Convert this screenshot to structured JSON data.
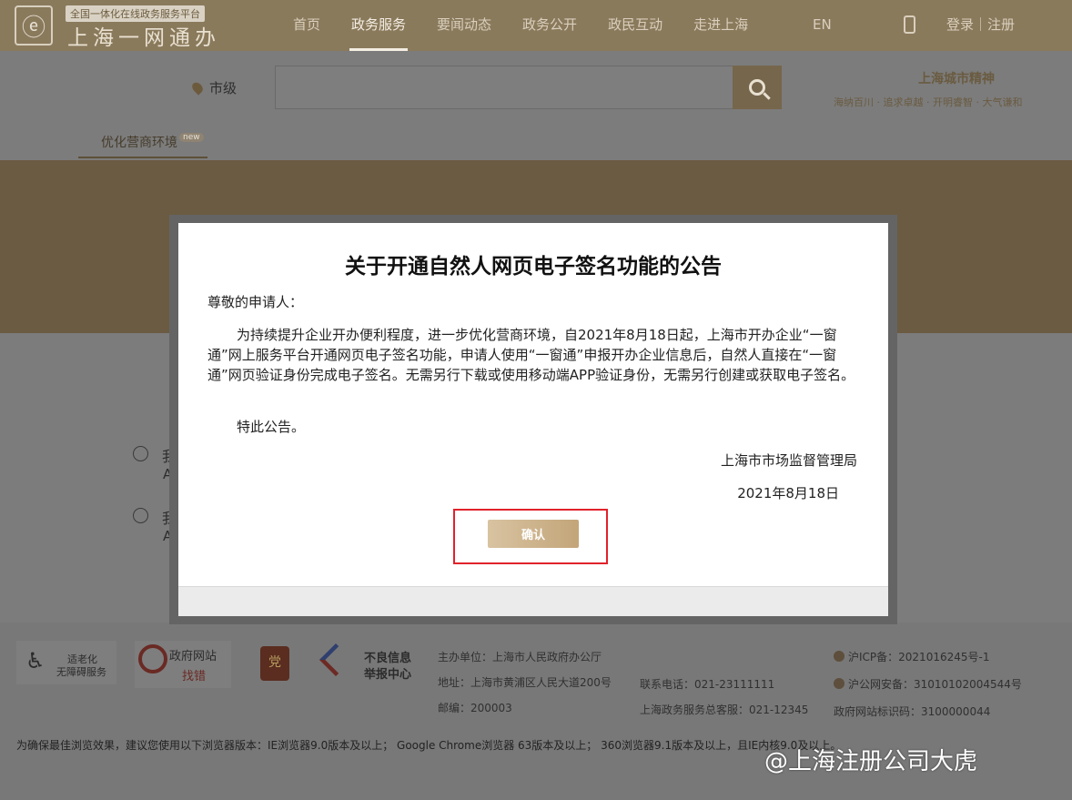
{
  "header": {
    "logo_tag": "全国一体化在线政务服务平台",
    "logo_name": "上海一网通办",
    "nav": [
      "首页",
      "政务服务",
      "要闻动态",
      "政务公开",
      "政民互动",
      "走进上海"
    ],
    "lang": "EN",
    "login": "登录｜注册"
  },
  "search": {
    "region": "市级",
    "placeholder": "",
    "spirit_title": "上海城市精神",
    "spirit_sub": "海纳百川 · 追求卓越 · 开明睿智 · 大气谦和"
  },
  "subtab": {
    "label": "优化营商环境",
    "badge": "new"
  },
  "options": [
    {
      "line1": "我",
      "line2": "A"
    },
    {
      "line1": "我",
      "line2": "A"
    }
  ],
  "modal": {
    "title": "关于开通自然人网页电子签名功能的公告",
    "greeting": "尊敬的申请人：",
    "body": "为持续提升企业开办便利程度，进一步优化营商环境，自2021年8月18日起，上海市开办企业“一窗通”网上服务平台开通网页电子签名功能，申请人使用“一窗通”申报开办企业信息后，自然人直接在“一窗通”网页验证身份完成电子签名。无需另行下载或使用移动端APP验证身份，无需另行创建或获取电子签名。",
    "special": "特此公告。",
    "org": "上海市市场监督管理局",
    "date": "2021年8月18日",
    "confirm": "确认"
  },
  "footer": {
    "badge1_l1": "适老化",
    "badge1_l2": "无障碍服务",
    "badge2_l1": "政府网站",
    "badge2_l2": "找错",
    "badge4_l1": "不良信息",
    "badge4_l2": "举报中心",
    "host": "主办单位：上海市人民政府办公厅",
    "address": "地址：上海市黄浦区人民大道200号",
    "postcode": "邮编：200003",
    "phone": "联系电话：021-23111111",
    "hotline": "上海政务服务总客服：021-12345",
    "icp": "沪ICP备：2021016245号-1",
    "police": "沪公网安备：31010102004544号",
    "site_code": "政府网站标识码：3100000044",
    "browser_note": "为确保最佳浏览效果，建议您使用以下浏览器版本：IE浏览器9.0版本及以上；  Google Chrome浏览器 63版本及以上；  360浏览器9.1版本及以上，且IE内核9.0及以上。",
    "watermark": "@上海注册公司大虎"
  },
  "colors": {
    "header_bg": "#8a7a5c",
    "accent_gold": "#c3a579",
    "highlight_red": "#e0222b"
  }
}
